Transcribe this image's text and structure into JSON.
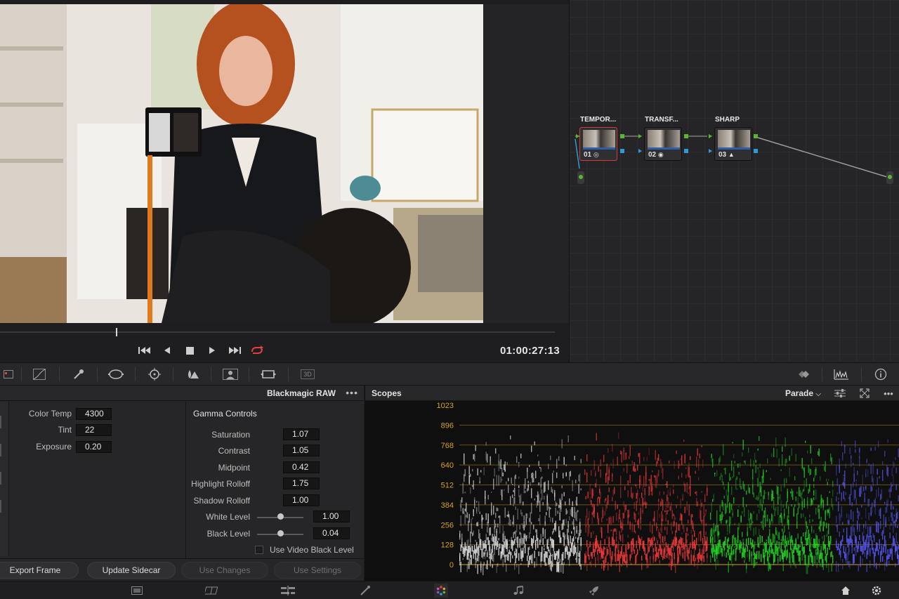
{
  "viewer": {
    "timecode": "01:00:27:13",
    "transport": [
      "skip-to-start",
      "step-back",
      "stop",
      "play",
      "skip-to-end",
      "loop"
    ]
  },
  "nodes": [
    {
      "title": "TEMPOR...",
      "number": "01",
      "selected": true
    },
    {
      "title": "TRANSF...",
      "number": "02",
      "selected": false
    },
    {
      "title": "SHARP",
      "number": "03",
      "selected": false
    }
  ],
  "toolbar": {
    "left_tools": [
      "panel-icon",
      "curves-icon",
      "qualifier-icon",
      "window-icon",
      "tracker-icon",
      "blur-icon",
      "key-icon",
      "sizing-icon",
      "3d-icon"
    ],
    "tool_3d_label": "3D",
    "right_tools": [
      "keyframe-icon",
      "scopes-icon",
      "info-icon"
    ]
  },
  "raw_panel": {
    "title": "Blackmagic RAW",
    "menu": "•••",
    "fields": [
      {
        "label": "Color Temp",
        "value": "4300"
      },
      {
        "label": "Tint",
        "value": "22"
      },
      {
        "label": "Exposure",
        "value": "0.20"
      }
    ],
    "gamma": {
      "title": "Gamma Controls",
      "fields": [
        {
          "label": "Saturation",
          "value": "1.07"
        },
        {
          "label": "Contrast",
          "value": "1.05"
        },
        {
          "label": "Midpoint",
          "value": "0.42"
        },
        {
          "label": "Highlight Rolloff",
          "value": "1.75"
        },
        {
          "label": "Shadow Rolloff",
          "value": "1.00"
        }
      ],
      "sliders": [
        {
          "label": "White Level",
          "value": "1.00",
          "level": 0.45
        },
        {
          "label": "Black Level",
          "value": "0.04",
          "level": 0.45
        }
      ],
      "checkbox_label": "Use Video Black Level",
      "checkbox_checked": false
    },
    "buttons": [
      {
        "label": "Export Frame",
        "enabled": true
      },
      {
        "label": "Update Sidecar",
        "enabled": true
      },
      {
        "label": "Use Changes",
        "enabled": false
      },
      {
        "label": "Use Settings",
        "enabled": false
      }
    ]
  },
  "scopes": {
    "title": "Scopes",
    "mode": "Parade",
    "menu": "•••",
    "axis_labels": [
      "1023",
      "896",
      "768",
      "640",
      "512",
      "384",
      "256",
      "128",
      "0"
    ],
    "axis_color": "#d4a21f"
  },
  "pages": [
    "media-icon",
    "cut-icon",
    "edit-icon",
    "fusion-icon",
    "color-icon",
    "fairlight-icon",
    "deliver-icon"
  ],
  "pagebar_right": [
    "home-icon",
    "settings-icon"
  ],
  "colors": {
    "accent_red": "#e04040",
    "node_green": "#5cb531",
    "node_blue": "#2a9bd8"
  }
}
